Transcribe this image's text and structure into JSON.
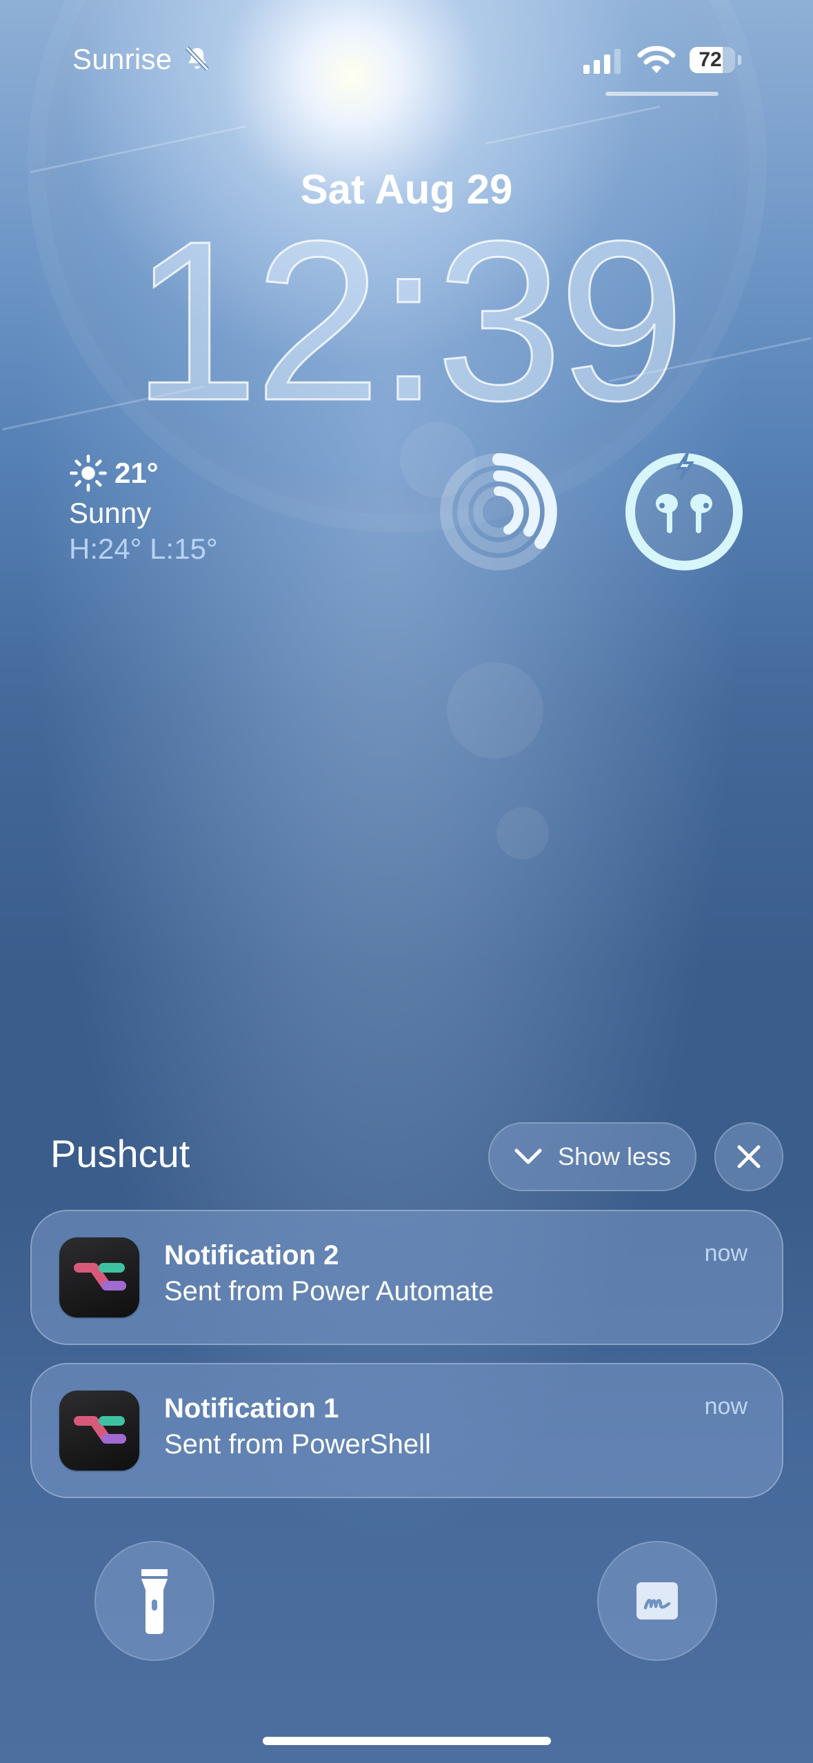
{
  "status_bar": {
    "carrier": "Sunrise",
    "silent_icon": "bell-slash-icon",
    "signal_icon": "cellular-signal-icon",
    "signal_bars": 3,
    "wifi_icon": "wifi-icon",
    "battery_level": "72",
    "battery_fraction": 0.72
  },
  "lock_screen": {
    "date": "Sat Aug 29",
    "time": "12:39"
  },
  "widgets": {
    "weather": {
      "icon": "sun-icon",
      "temperature": "21°",
      "condition": "Sunny",
      "high_low": "H:24° L:15°"
    },
    "activity": {
      "icon": "activity-rings-icon"
    },
    "airpods": {
      "icon": "airpods-charging-icon"
    }
  },
  "notification_group": {
    "app_name": "Pushcut",
    "show_less_label": "Show less",
    "close_icon": "close-icon",
    "notifications": [
      {
        "title": "Notification 2",
        "body": "Sent from Power Automate",
        "time": "now",
        "icon": "pushcut-app-icon"
      },
      {
        "title": "Notification 1",
        "body": "Sent from PowerShell",
        "time": "now",
        "icon": "pushcut-app-icon"
      }
    ]
  },
  "quick_actions": {
    "left_icon": "flashlight-icon",
    "right_icon": "freeform-icon"
  },
  "colors": {
    "sky_top": "#8fb0d6",
    "sky_bottom": "#3b5d8b",
    "text": "#ffffff",
    "airpods_ring": "#d6f6fb"
  }
}
